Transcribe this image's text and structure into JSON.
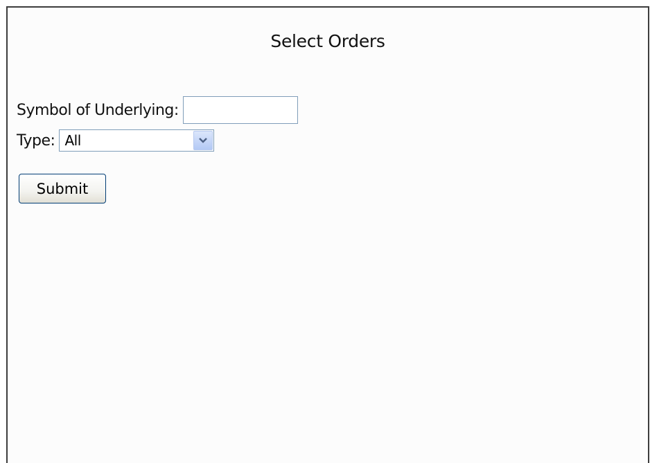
{
  "page": {
    "title": "Select Orders"
  },
  "form": {
    "symbol_label": "Symbol of Underlying:",
    "symbol_value": "",
    "type_label": "Type:",
    "type_selected": "All",
    "submit_label": "Submit"
  },
  "icons": {
    "dropdown": "chevron-down-icon"
  },
  "colors": {
    "input_border": "#7f9db9",
    "button_border": "#003c74",
    "frame_border": "#3c3c3c"
  }
}
